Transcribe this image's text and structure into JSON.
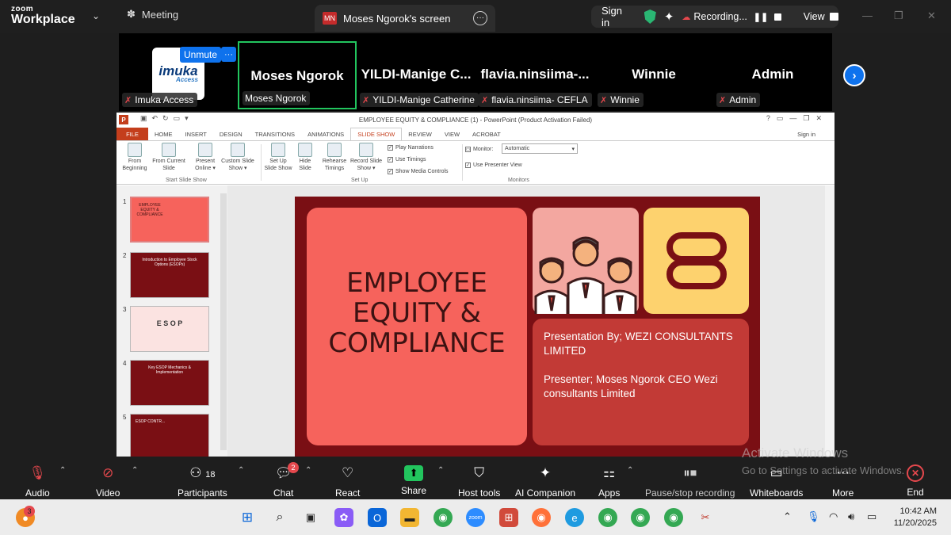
{
  "app": {
    "brand_top": "zoom",
    "brand_bottom": "Workplace"
  },
  "top": {
    "meeting_label": "Meeting",
    "share_initials": "MN",
    "share_tab": "Moses Ngorok's screen",
    "sign_in": "Sign in",
    "recording": "Recording...",
    "view": "View"
  },
  "gallery": {
    "unmute": "Unmute",
    "logo_main": "imuka",
    "logo_sub": "Access",
    "tiles": [
      {
        "big": "",
        "label": "Imuka Access"
      },
      {
        "big": "Moses Ngorok",
        "label": "Moses Ngorok"
      },
      {
        "big": "YILDI-Manige  C...",
        "label": "YILDI-Manige Catherine"
      },
      {
        "big": "flavia.ninsiima-...",
        "label": "flavia.ninsiima- CEFLA"
      },
      {
        "big": "Winnie",
        "label": "Winnie"
      },
      {
        "big": "Admin",
        "label": "Admin"
      }
    ]
  },
  "ppt": {
    "title": "EMPLOYEE EQUITY & COMPLIANCE (1) - PowerPoint (Product Activation Failed)",
    "sign_in": "Sign in",
    "tabs": [
      "FILE",
      "HOME",
      "INSERT",
      "DESIGN",
      "TRANSITIONS",
      "ANIMATIONS",
      "SLIDE SHOW",
      "REVIEW",
      "VIEW",
      "ACROBAT"
    ],
    "ribbon": {
      "from_beginning": "From Beginning",
      "from_current": "From Current Slide",
      "present_online": "Present Online ▾",
      "custom_show": "Custom Slide Show ▾",
      "group_start": "Start Slide Show",
      "setup_show": "Set Up Slide Show",
      "hide_slide": "Hide Slide",
      "rehearse": "Rehearse Timings",
      "record": "Record Slide Show ▾",
      "play_narrations": "Play Narrations",
      "use_timings": "Use Timings",
      "show_media": "Show Media Controls",
      "group_setup": "Set Up",
      "monitor_label": "Monitor:",
      "monitor_value": "Automatic",
      "presenter_view": "Use Presenter View",
      "group_monitors": "Monitors"
    },
    "thumbs": [
      {
        "num": "1",
        "text": "EMPLOYEE EQUITY & COMPLIANCE"
      },
      {
        "num": "2",
        "text": "Introduction to Employee Stock Options (ESOPs)"
      },
      {
        "num": "3",
        "text": "E S O P"
      },
      {
        "num": "4",
        "text": "Key ESOP Mechanics & Implementation"
      },
      {
        "num": "5",
        "text": "ESOP CONTR..."
      }
    ],
    "slide": {
      "heading_line1": "EMPLOYEE",
      "heading_line2": "EQUITY &",
      "heading_line3": "COMPLIANCE",
      "presented_by": "Presentation By; WEZI CONSULTANTS LIMITED",
      "presenter": "Presenter; Moses Ngorok CEO Wezi consultants Limited"
    }
  },
  "toolbar": {
    "audio": "Audio",
    "video": "Video",
    "participants": "Participants",
    "participants_count": "18",
    "chat": "Chat",
    "chat_badge": "2",
    "react": "React",
    "share": "Share",
    "host_tools": "Host tools",
    "ai_companion": "AI Companion",
    "apps": "Apps",
    "pause_stop": "Pause/stop recording",
    "whiteboards": "Whiteboards",
    "more": "More",
    "end": "End"
  },
  "watermark": {
    "line1": "Activate Windows",
    "line2": "Go to Settings to activate Windows."
  },
  "taskbar": {
    "notif_badge": "3",
    "time": "10:42 AM",
    "date": "11/20/2025"
  }
}
